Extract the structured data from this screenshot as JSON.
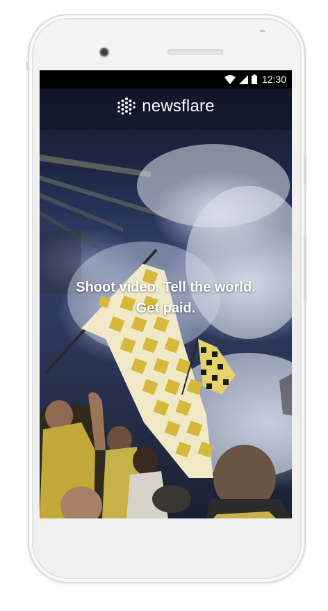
{
  "status_bar": {
    "time": "12:30",
    "icons": [
      "wifi-icon",
      "cellular-signal-icon",
      "battery-icon"
    ]
  },
  "app": {
    "brand_name": "newsflare",
    "logo_icon": "newsflare-logo-icon"
  },
  "hero": {
    "line1": "Shoot video. Tell the world.",
    "line2": "Get paid."
  },
  "colors": {
    "status_bar_bg": "#000000",
    "text": "#ffffff",
    "flag_yellow": "#e2c644",
    "device_frame": "#f1f1f1"
  }
}
